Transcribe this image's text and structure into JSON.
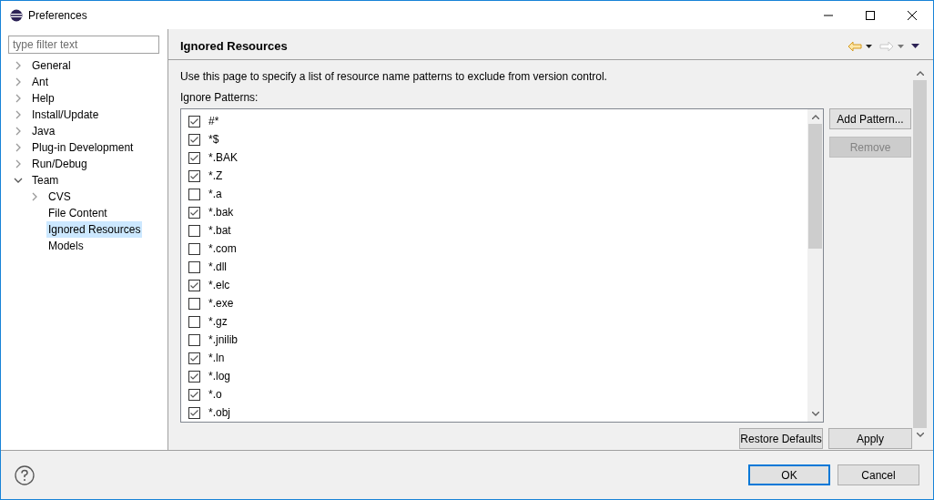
{
  "window": {
    "title": "Preferences"
  },
  "filter": {
    "placeholder": "type filter text"
  },
  "tree": [
    {
      "label": "General",
      "expanded": false,
      "selected": false
    },
    {
      "label": "Ant",
      "expanded": false,
      "selected": false
    },
    {
      "label": "Help",
      "expanded": false,
      "selected": false
    },
    {
      "label": "Install/Update",
      "expanded": false,
      "selected": false
    },
    {
      "label": "Java",
      "expanded": false,
      "selected": false
    },
    {
      "label": "Plug-in Development",
      "expanded": false,
      "selected": false
    },
    {
      "label": "Run/Debug",
      "expanded": false,
      "selected": false
    },
    {
      "label": "Team",
      "expanded": true,
      "selected": false,
      "children": [
        {
          "label": "CVS",
          "expanded": false,
          "selected": false
        },
        {
          "label": "File Content",
          "selected": false
        },
        {
          "label": "Ignored Resources",
          "selected": true
        },
        {
          "label": "Models",
          "selected": false
        }
      ]
    }
  ],
  "page": {
    "title": "Ignored Resources",
    "history": {
      "back_enabled": true,
      "forward_enabled": false
    },
    "description": "Use this page to specify a list of resource name patterns to exclude from version control.",
    "list_label": "Ignore Patterns:",
    "patterns": [
      {
        "label": "#*",
        "checked": true
      },
      {
        "label": "*$",
        "checked": true
      },
      {
        "label": "*.BAK",
        "checked": true
      },
      {
        "label": "*.Z",
        "checked": true
      },
      {
        "label": "*.a",
        "checked": false
      },
      {
        "label": "*.bak",
        "checked": true
      },
      {
        "label": "*.bat",
        "checked": false
      },
      {
        "label": "*.com",
        "checked": false
      },
      {
        "label": "*.dll",
        "checked": false
      },
      {
        "label": "*.elc",
        "checked": true
      },
      {
        "label": "*.exe",
        "checked": false
      },
      {
        "label": "*.gz",
        "checked": false
      },
      {
        "label": "*.jnilib",
        "checked": false
      },
      {
        "label": "*.ln",
        "checked": true
      },
      {
        "label": "*.log",
        "checked": true
      },
      {
        "label": "*.o",
        "checked": true
      },
      {
        "label": "*.obj",
        "checked": true
      }
    ],
    "side_buttons": [
      {
        "label": "Add Pattern...",
        "disabled": false
      },
      {
        "label": "Remove",
        "disabled": true
      }
    ],
    "page_buttons": [
      {
        "label": "Restore Defaults"
      },
      {
        "label": "Apply"
      }
    ]
  },
  "dialog_buttons": [
    {
      "label": "OK",
      "default": true
    },
    {
      "label": "Cancel",
      "default": false
    }
  ]
}
